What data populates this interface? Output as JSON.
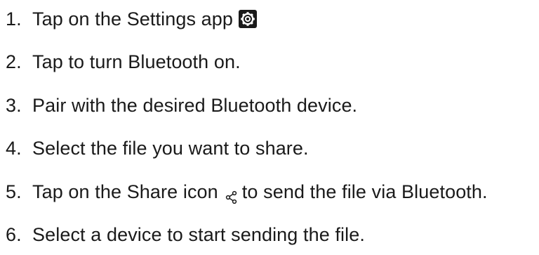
{
  "steps": [
    {
      "number": "1.",
      "text_before": "Tap on the Settings app",
      "icon": "gear-icon"
    },
    {
      "number": "2.",
      "text": "Tap to turn Bluetooth on."
    },
    {
      "number": "3.",
      "text": "Pair with the desired Bluetooth device."
    },
    {
      "number": "4.",
      "text": "Select the file you want to share."
    },
    {
      "number": "5.",
      "text_before": "Tap on the Share icon",
      "icon": "share-icon",
      "text_after": "to send the file via Bluetooth."
    },
    {
      "number": "6.",
      "text": "Select a device to start sending the file."
    }
  ]
}
